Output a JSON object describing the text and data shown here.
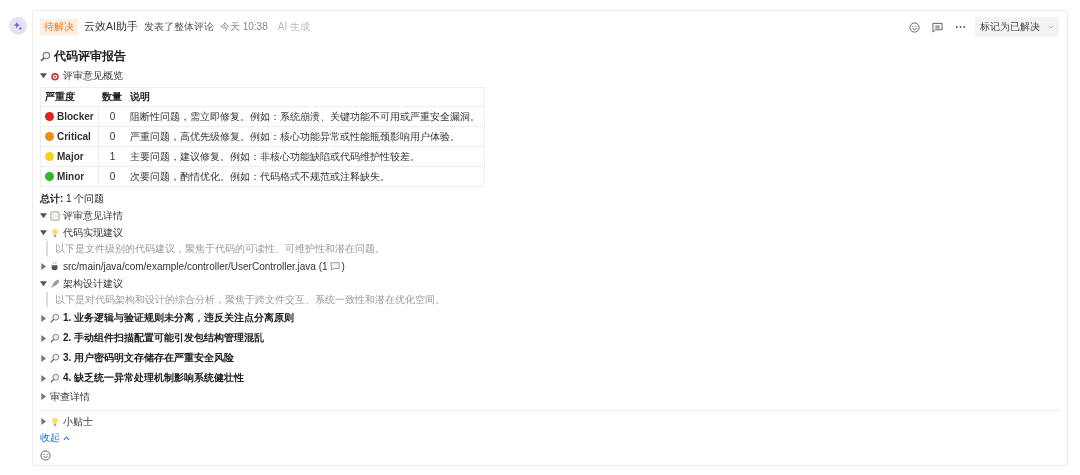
{
  "header": {
    "status": "待解决",
    "author": "云效AI助手",
    "action": "发表了整体评论",
    "time": "今天 10:38",
    "ai_tag": "AI 生成",
    "resolve_button": "标记为已解决"
  },
  "report": {
    "title": "代码评审报告",
    "overview": {
      "label": "评审意见概览",
      "expanded": true
    },
    "table": {
      "columns": [
        "严重度",
        "数量",
        "说明"
      ],
      "rows": [
        {
          "severity": "Blocker",
          "color": "#e02020",
          "count": "0",
          "description": "阻断性问题，需立即修复。例如：系统崩溃、关键功能不可用或严重安全漏洞。"
        },
        {
          "severity": "Critical",
          "color": "#f08a1c",
          "count": "0",
          "description": "严重问题，高优先级修复。例如：核心功能异常或性能瓶颈影响用户体验。"
        },
        {
          "severity": "Major",
          "color": "#f5d01e",
          "count": "1",
          "description": "主要问题，建议修复。例如：非核心功能缺陷或代码维护性较差。"
        },
        {
          "severity": "Minor",
          "color": "#2fb52f",
          "count": "0",
          "description": "次要问题，酌情优化。例如：代码格式不规范或注释缺失。"
        }
      ]
    },
    "total": "**总计:** 1 个问题",
    "sections": [
      {
        "kind": "details",
        "label": "评审意见详情",
        "expanded": true
      },
      {
        "kind": "impl",
        "label": "代码实现建议",
        "expanded": true,
        "note": "以下是文件级别的代码建议，聚焦于代码的可读性、可维护性和潜在问题。",
        "items": [
          {
            "kind": "file",
            "label": "src/main/java/com/example/controller/UserController.java (1",
            "label_end": ")",
            "expanded": false
          }
        ]
      },
      {
        "kind": "arch",
        "label": "架构设计建议",
        "expanded": true,
        "note": "以下是对代码架构和设计的综合分析，聚焦于跨文件交互、系统一致性和潜在优化空间。",
        "items": [
          {
            "kind": "issue",
            "label": "1. 业务逻辑与验证规则未分离，违反关注点分离原则",
            "expanded": false
          },
          {
            "kind": "issue",
            "label": "2. 手动组件扫描配置可能引发包结构管理混乱",
            "expanded": false
          },
          {
            "kind": "issue",
            "label": "3. 用户密码明文存储存在严重安全风险",
            "expanded": false
          },
          {
            "kind": "issue",
            "label": "4. 缺乏统一异常处理机制影响系统健壮性",
            "expanded": false
          }
        ]
      },
      {
        "kind": "plain",
        "label": "审查详情",
        "expanded": false
      }
    ],
    "tips": {
      "label": "小贴士",
      "expanded": false
    },
    "collapse_link": "收起"
  }
}
